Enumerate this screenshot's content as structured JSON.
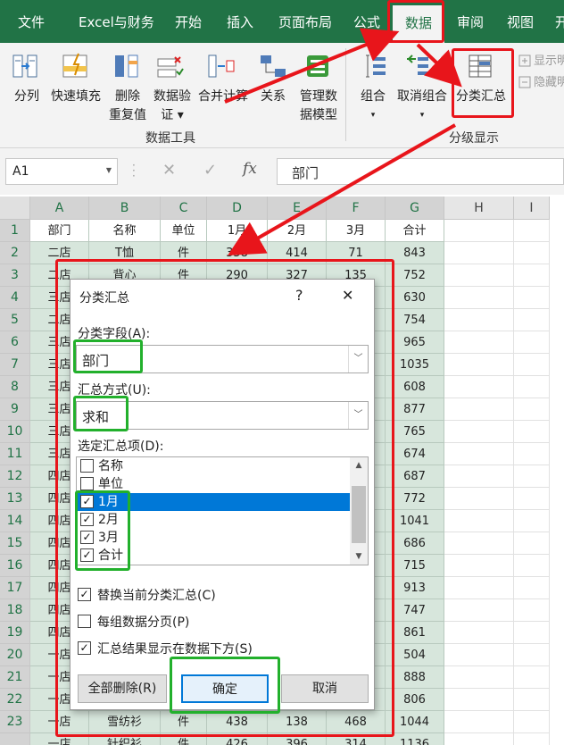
{
  "tabs": [
    "文件",
    "Excel与财务",
    "开始",
    "插入",
    "页面布局",
    "公式",
    "数据",
    "审阅",
    "视图",
    "开"
  ],
  "ribbon": {
    "tools": [
      {
        "label1": "分列",
        "label2": ""
      },
      {
        "label1": "快速填充",
        "label2": ""
      },
      {
        "label1": "删除",
        "label2": "重复值"
      },
      {
        "label1": "数据验",
        "label2": "证 ▾"
      },
      {
        "label1": "合并计算",
        "label2": ""
      },
      {
        "label1": "关系",
        "label2": ""
      },
      {
        "label1": "管理数",
        "label2": "据模型"
      }
    ],
    "group_data_tools": "数据工具",
    "outline": {
      "group_label": "组合",
      "group_arrow": "▾",
      "ungroup_label": "取消组合",
      "ungroup_arrow": "▾",
      "subtotal_label": "分类汇总",
      "show_detail": "显示明",
      "hide_detail": "隐藏明",
      "group_name": "分级显示"
    }
  },
  "formula_bar": {
    "name_box": "A1",
    "fx": "fx",
    "content": "部门"
  },
  "sheet": {
    "columns": [
      "A",
      "B",
      "C",
      "D",
      "E",
      "F",
      "G",
      "H",
      "I"
    ],
    "rows": [
      "1",
      "2",
      "3",
      "4",
      "5",
      "6",
      "7",
      "8",
      "9",
      "10",
      "11",
      "12",
      "13",
      "14",
      "15",
      "16",
      "17",
      "18",
      "19",
      "20",
      "21",
      "22",
      "23",
      ""
    ],
    "header": [
      "部门",
      "名称",
      "单位",
      "1月",
      "2月",
      "3月",
      "合计"
    ],
    "data": [
      [
        "二店",
        "T恤",
        "件",
        "358",
        "414",
        "71",
        "843"
      ],
      [
        "二店",
        "背心",
        "件",
        "290",
        "327",
        "135",
        "752"
      ],
      [
        "三店",
        "",
        "",
        "",
        "",
        "",
        "630"
      ],
      [
        "二店",
        "",
        "",
        "",
        "",
        "",
        "754"
      ],
      [
        "三店",
        "",
        "",
        "",
        "",
        "",
        "965"
      ],
      [
        "三店",
        "",
        "",
        "",
        "",
        "",
        "1035"
      ],
      [
        "三店",
        "",
        "",
        "",
        "",
        "",
        "608"
      ],
      [
        "三店",
        "",
        "",
        "",
        "",
        "",
        "877"
      ],
      [
        "三店",
        "",
        "",
        "",
        "",
        "",
        "765"
      ],
      [
        "三店",
        "",
        "",
        "",
        "",
        "",
        "674"
      ],
      [
        "四店",
        "",
        "",
        "",
        "",
        "",
        "687"
      ],
      [
        "四店",
        "",
        "",
        "",
        "",
        "",
        "772"
      ],
      [
        "四店",
        "",
        "",
        "",
        "",
        "",
        "1041"
      ],
      [
        "四店",
        "",
        "",
        "",
        "",
        "",
        "686"
      ],
      [
        "四店",
        "",
        "",
        "",
        "",
        "",
        "715"
      ],
      [
        "四店",
        "",
        "",
        "",
        "",
        "",
        "913"
      ],
      [
        "四店",
        "",
        "",
        "",
        "",
        "",
        "747"
      ],
      [
        "四店",
        "",
        "",
        "",
        "",
        "",
        "861"
      ],
      [
        "一店",
        "",
        "",
        "",
        "",
        "",
        "504"
      ],
      [
        "一店",
        "",
        "",
        "",
        "",
        "",
        "888"
      ],
      [
        "一店",
        "",
        "",
        "",
        "",
        "",
        "806"
      ],
      [
        "一店",
        "雪纺衫",
        "件",
        "438",
        "138",
        "468",
        "1044"
      ],
      [
        "一店",
        "针织衫",
        "件",
        "426",
        "396",
        "314",
        "1136"
      ]
    ]
  },
  "dialog": {
    "title": "分类汇总",
    "help": "?",
    "close": "✕",
    "field_label": "分类字段(A):",
    "field_value": "部门",
    "method_label": "汇总方式(U):",
    "method_value": "求和",
    "items_label": "选定汇总项(D):",
    "items": [
      {
        "label": "名称",
        "checked": false
      },
      {
        "label": "单位",
        "checked": false
      },
      {
        "label": "1月",
        "checked": true
      },
      {
        "label": "2月",
        "checked": true
      },
      {
        "label": "3月",
        "checked": true
      },
      {
        "label": "合计",
        "checked": true
      }
    ],
    "options": [
      {
        "label": "替换当前分类汇总(C)",
        "checked": true
      },
      {
        "label": "每组数据分页(P)",
        "checked": false
      },
      {
        "label": "汇总结果显示在数据下方(S)",
        "checked": true
      }
    ],
    "btn_remove": "全部删除(R)",
    "btn_ok": "确定",
    "btn_cancel": "取消"
  },
  "colors": {
    "excel_green": "#217346",
    "highlight_red": "#e8151b",
    "highlight_green": "#22b02c",
    "selection_blue": "#0078d7",
    "cell_select": "#d7e6dc"
  }
}
